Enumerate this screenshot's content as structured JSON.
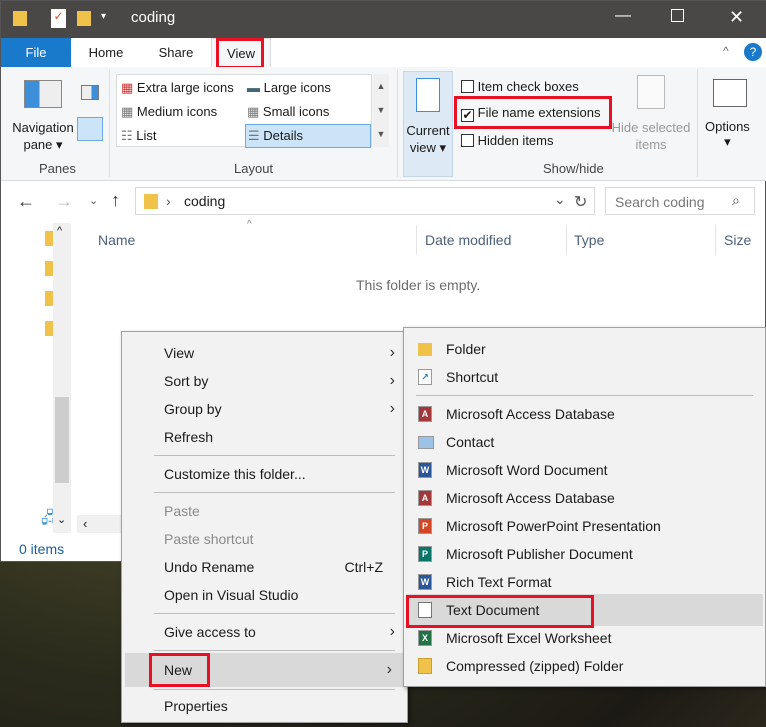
{
  "window": {
    "title": "coding"
  },
  "tabs": [
    {
      "label": "File"
    },
    {
      "label": "Home"
    },
    {
      "label": "Share"
    },
    {
      "label": "View"
    }
  ],
  "ribbon": {
    "panes": {
      "nav_label1": "Navigation",
      "nav_label2": "pane",
      "group": "Panes"
    },
    "layout": {
      "items": [
        "Extra large icons",
        "Large icons",
        "Medium icons",
        "Small icons",
        "List",
        "Details"
      ],
      "selected": "Details",
      "group": "Layout"
    },
    "current_view": {
      "label1": "Current",
      "label2": "view"
    },
    "showhide": {
      "item_check_boxes": "Item check boxes",
      "file_name_extensions": "File name extensions",
      "hidden_items": "Hidden items",
      "hide_selected1": "Hide selected",
      "hide_selected2": "items",
      "group": "Show/hide",
      "file_name_extensions_checked": true,
      "item_check_boxes_checked": false,
      "hidden_items_checked": false
    },
    "options": "Options"
  },
  "address": {
    "path": "coding",
    "search_placeholder": "Search coding"
  },
  "columns": [
    "Name",
    "Date modified",
    "Type",
    "Size"
  ],
  "empty_text": "This folder is empty.",
  "status": "0 items",
  "context_menu": {
    "items": [
      "View",
      "Sort by",
      "Group by",
      "Refresh",
      "Customize this folder...",
      "Paste",
      "Paste shortcut",
      "Undo Rename",
      "Open in Visual Studio",
      "Give access to",
      "New",
      "Properties"
    ],
    "undo_shortcut": "Ctrl+Z"
  },
  "new_submenu": {
    "items": [
      "Folder",
      "Shortcut",
      "Microsoft Access Database",
      "Contact",
      "Microsoft Word Document",
      "Microsoft Access Database",
      "Microsoft PowerPoint Presentation",
      "Microsoft Publisher Document",
      "Rich Text Format",
      "Text Document",
      "Microsoft Excel Worksheet",
      "Compressed (zipped) Folder"
    ]
  },
  "colors": {
    "accent": "#1979ca",
    "highlight_box": "#e81123",
    "selection": "#cce4f7"
  }
}
